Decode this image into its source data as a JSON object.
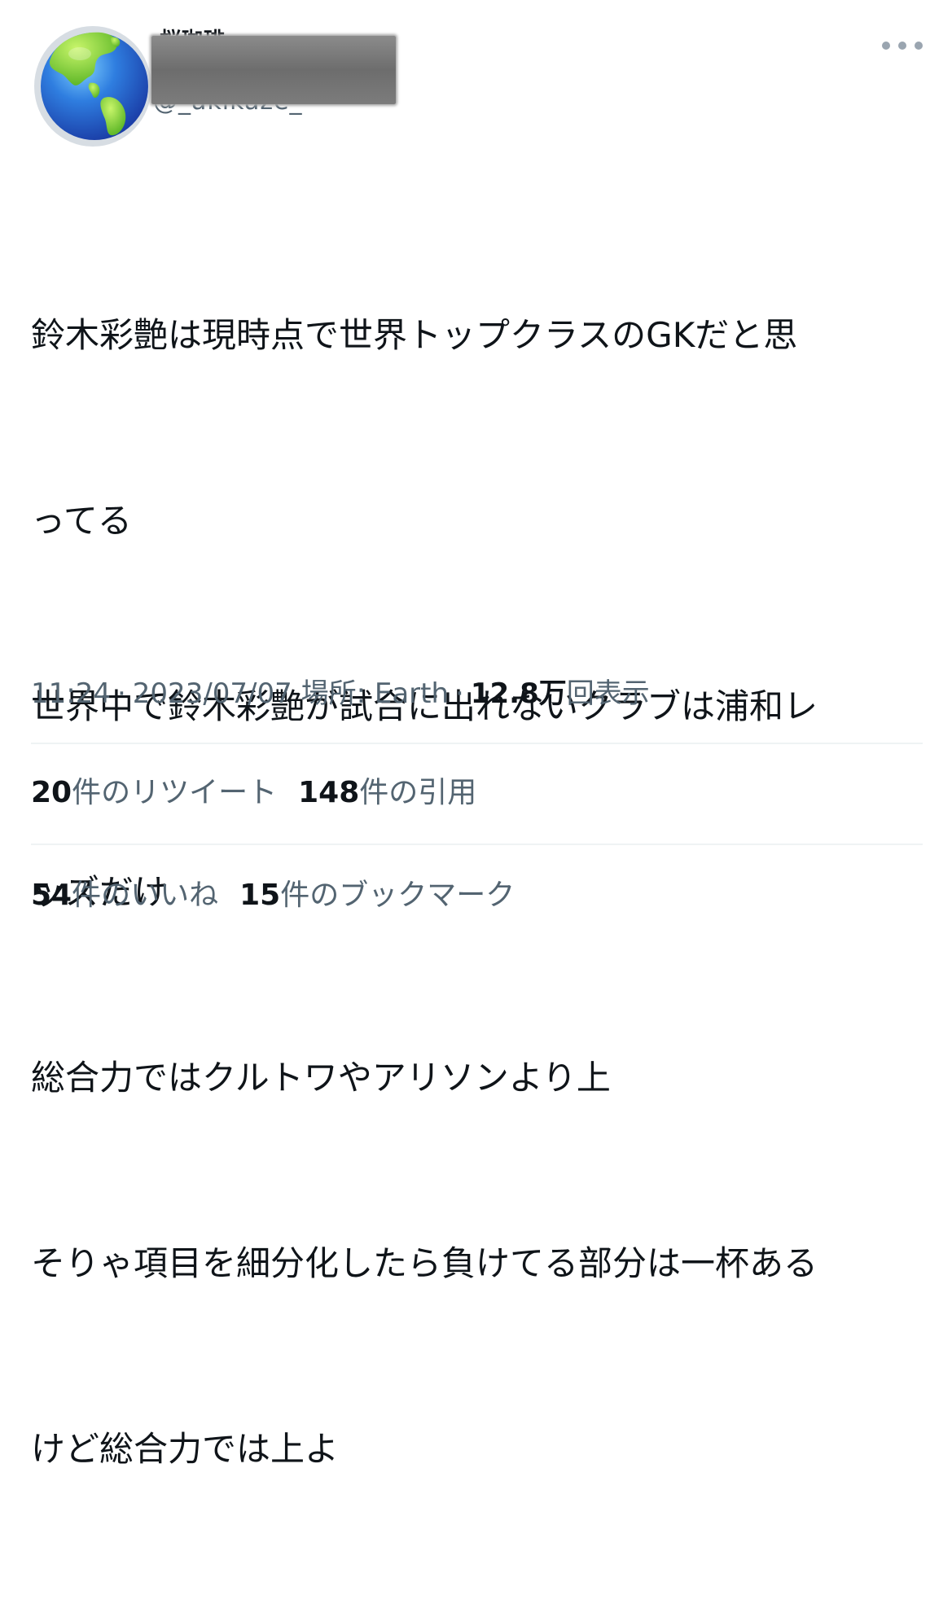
{
  "tweet": {
    "author": {
      "display_name": "桜珈琲",
      "handle": "@_akikaze_",
      "avatar_icon": "globe-earth-americas-icon"
    },
    "more_icon": "more-horizontal-icon",
    "text_lines": [
      "鈴木彩艶は現時点で世界トップクラスのGKだと思",
      "ってる",
      "世界中で鈴木彩艶が試合に出れないクラブは浦和レ",
      "ッズだけ",
      "総合力ではクルトワやアリソンより上",
      "そりゃ項目を細分化したら負けてる部分は一杯ある",
      "けど総合力では上よ"
    ],
    "meta": {
      "time": "11:24",
      "date": "2023/07/07",
      "location": "場所: Earth",
      "views_count": "12.8万",
      "views_label": "回表示",
      "separator": "·"
    },
    "stats": {
      "retweets_count": "20",
      "retweets_label": "件のリツイート",
      "quotes_count": "148",
      "quotes_label": "件の引用",
      "likes_count": "54",
      "likes_label": "件のいいね",
      "bookmarks_count": "15",
      "bookmarks_label": "件のブックマーク"
    },
    "colors": {
      "text_primary": "#0f1419",
      "text_secondary": "#536471",
      "divider": "#eff3f4",
      "redaction": "#777777"
    }
  }
}
